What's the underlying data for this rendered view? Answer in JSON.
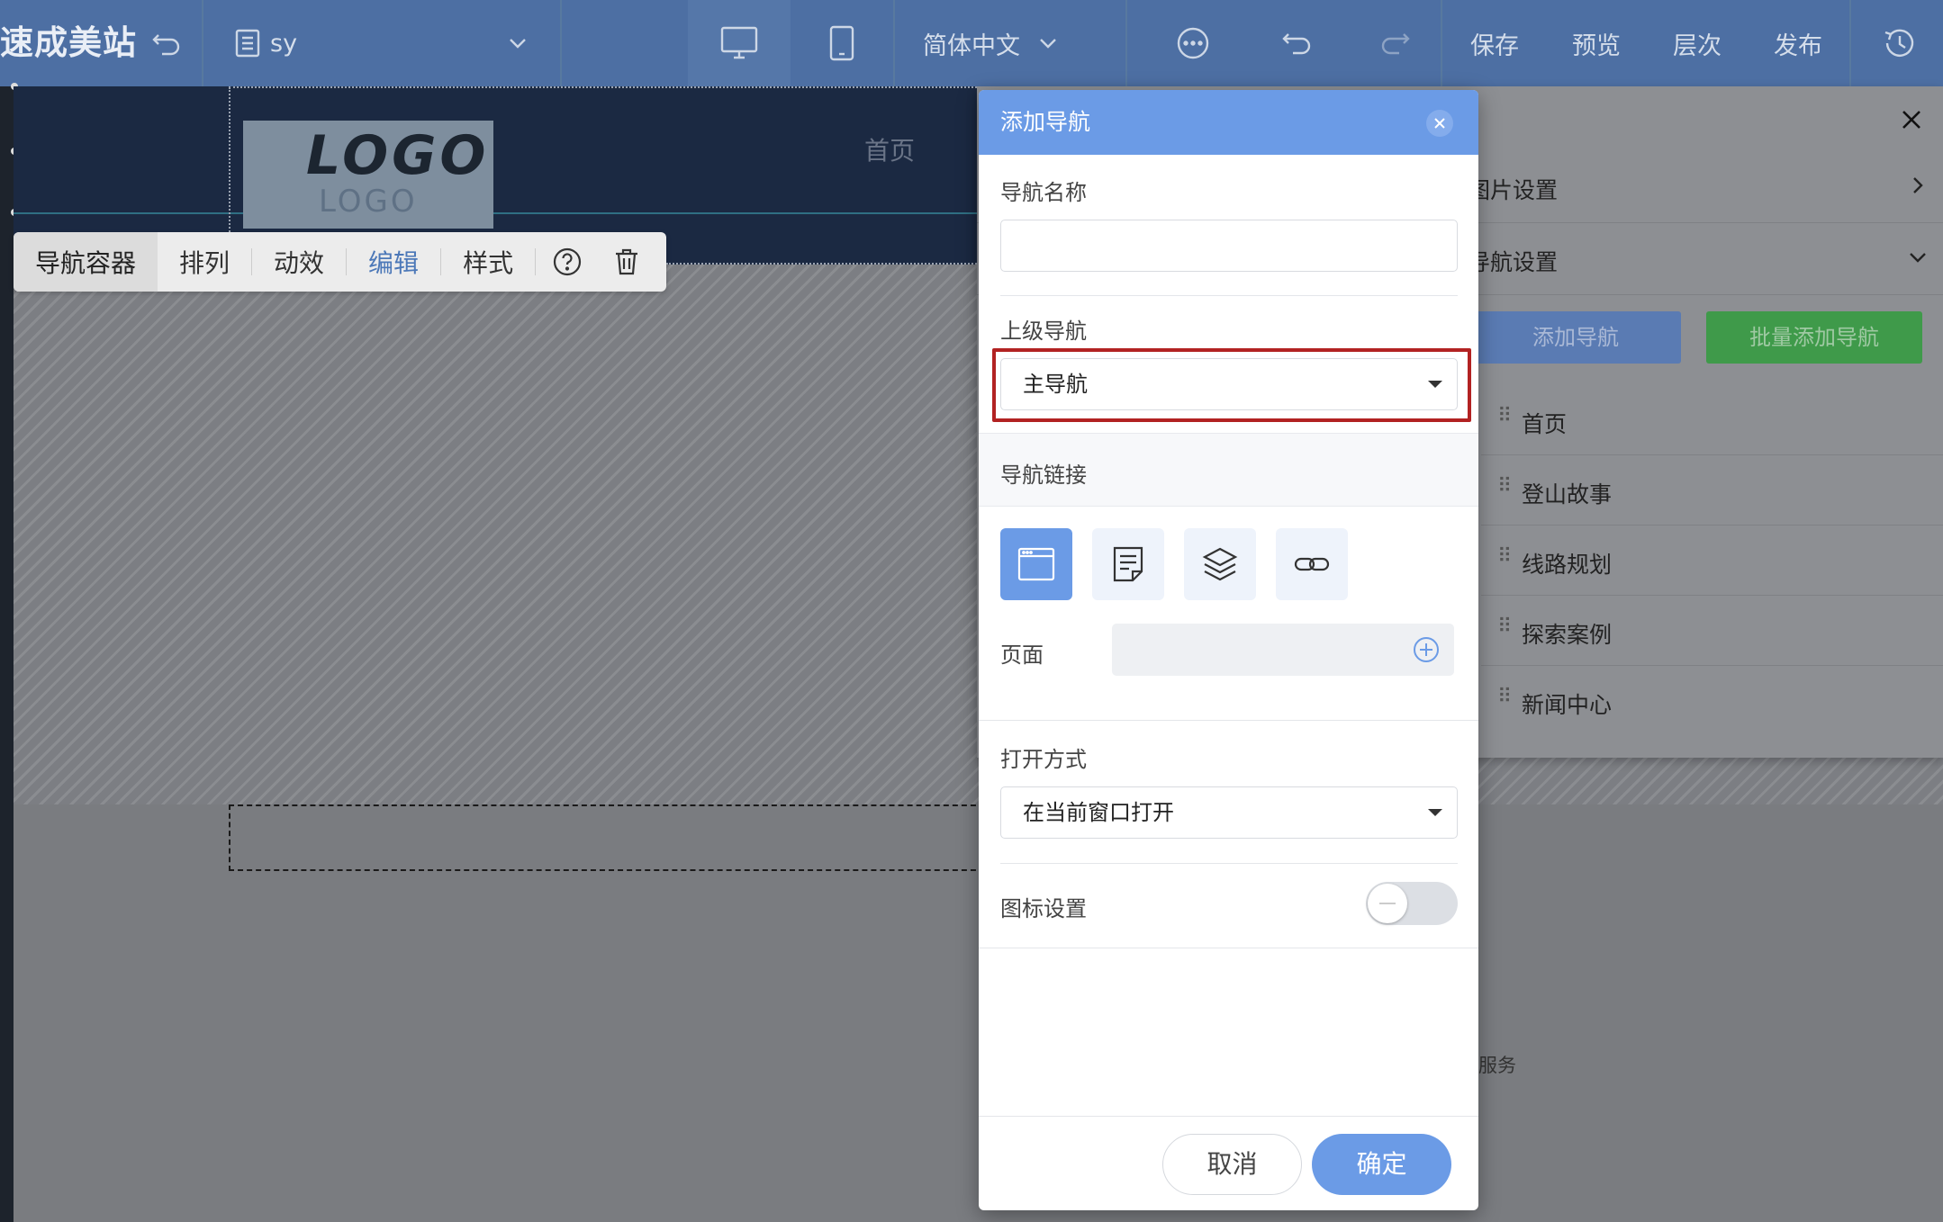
{
  "topbar": {
    "brand": "速成美站",
    "page_name": "sy",
    "language": "简体中文",
    "save": "保存",
    "preview": "预览",
    "layers": "层次",
    "publish": "发布"
  },
  "canvas": {
    "logo_text": "LOGO",
    "logo_subtext": "LOGO",
    "nav_home": "首页"
  },
  "float_toolbar": {
    "container": "导航容器",
    "arrange": "排列",
    "animation": "动效",
    "edit": "编辑",
    "style": "样式"
  },
  "right_panel": {
    "image_settings": "图片设置",
    "nav_settings": "导航设置",
    "add_nav": "添加导航",
    "batch_add_nav": "批量添加导航",
    "items": [
      "首页",
      "登山故事",
      "线路规划",
      "探索案例",
      "新闻中心"
    ],
    "colors": {
      "add": "#5a7bb3",
      "batch": "#3f9a4a"
    }
  },
  "bg_text": "服务",
  "dialog": {
    "title": "添加导航",
    "name_label": "导航名称",
    "name_value": "",
    "parent_label": "上级导航",
    "parent_value": "主导航",
    "link_label": "导航链接",
    "page_label": "页面",
    "page_value": "",
    "open_label": "打开方式",
    "open_value": "在当前窗口打开",
    "icon_label": "图标设置",
    "icon_enabled": false,
    "cancel": "取消",
    "confirm": "确定",
    "accent_color": "#6b9be6"
  }
}
